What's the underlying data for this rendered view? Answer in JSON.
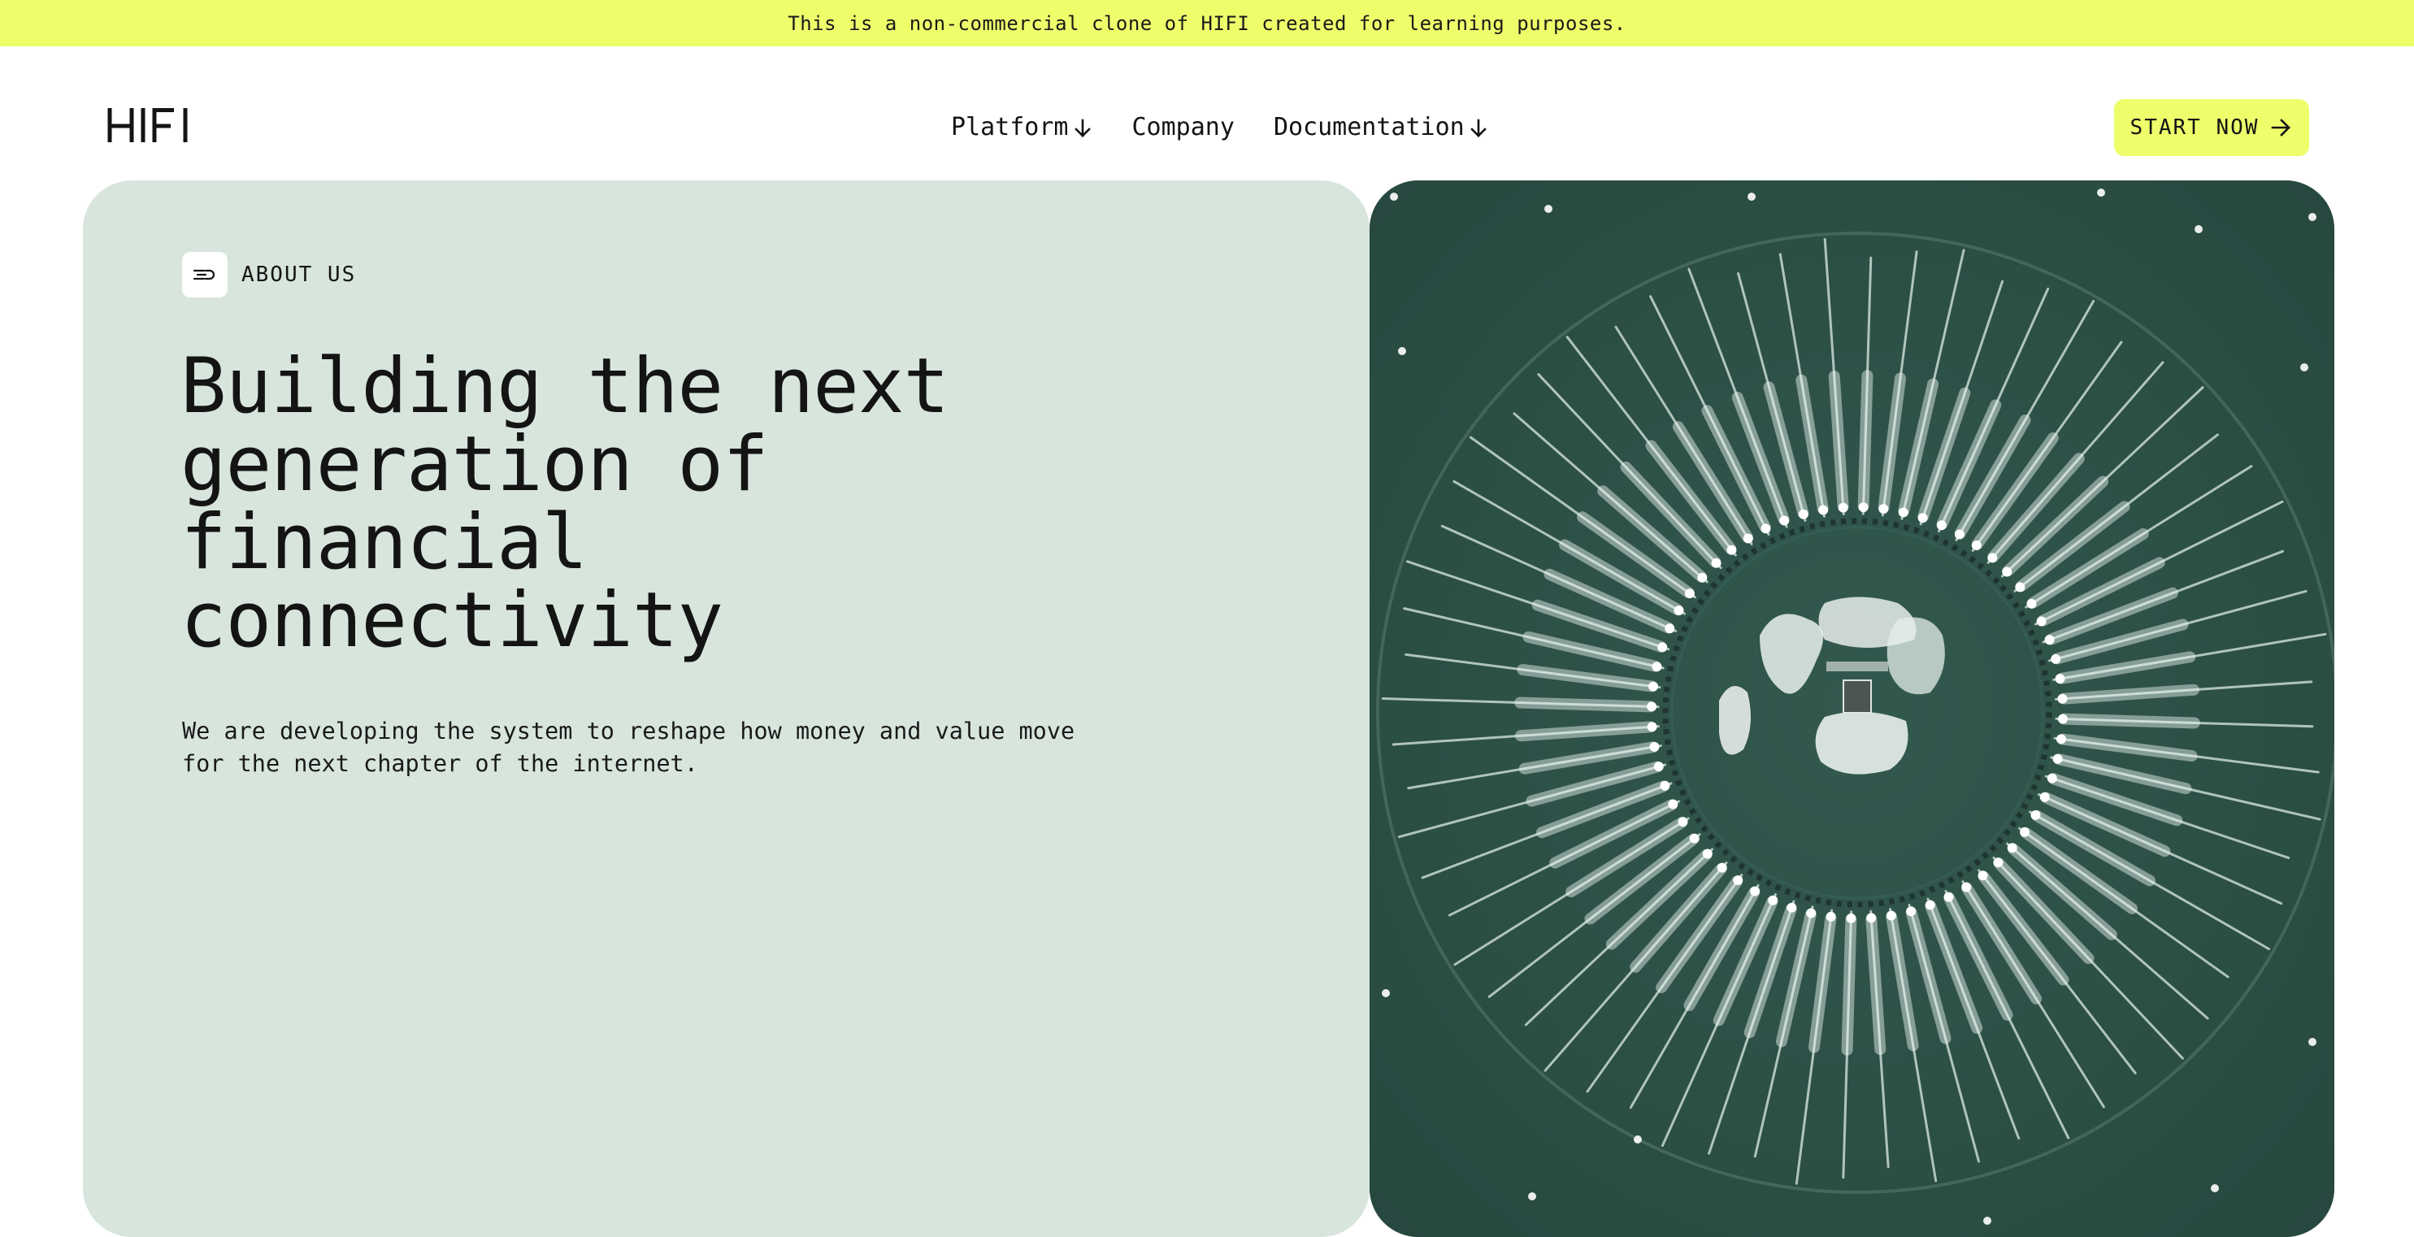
{
  "banner": {
    "text": "This is a non-commercial clone of HIFI created for learning purposes."
  },
  "nav": {
    "logo_alt": "HIFI",
    "links": [
      {
        "label": "Platform",
        "has_dropdown": true
      },
      {
        "label": "Company",
        "has_dropdown": false
      },
      {
        "label": "Documentation",
        "has_dropdown": true
      }
    ],
    "cta_label": "START NOW"
  },
  "hero": {
    "tag_label": "ABOUT US",
    "headline_lines": [
      "Building the next",
      "generation of",
      "financial",
      "connectivity"
    ],
    "lead_lines": [
      "We are developing the system to reshape how money and value move",
      "for the next chapter of the internet."
    ],
    "image_alt": "aerial-radial-boats-water"
  },
  "colors": {
    "accent": "#eefe6b",
    "hero_panel": "#d7e5dd",
    "image_water": "#2c5148",
    "text": "#141414"
  },
  "icons": {
    "nav_dropdown": "arrow-down-icon",
    "cta": "arrow-right-icon",
    "tag": "speed-lines-icon"
  }
}
